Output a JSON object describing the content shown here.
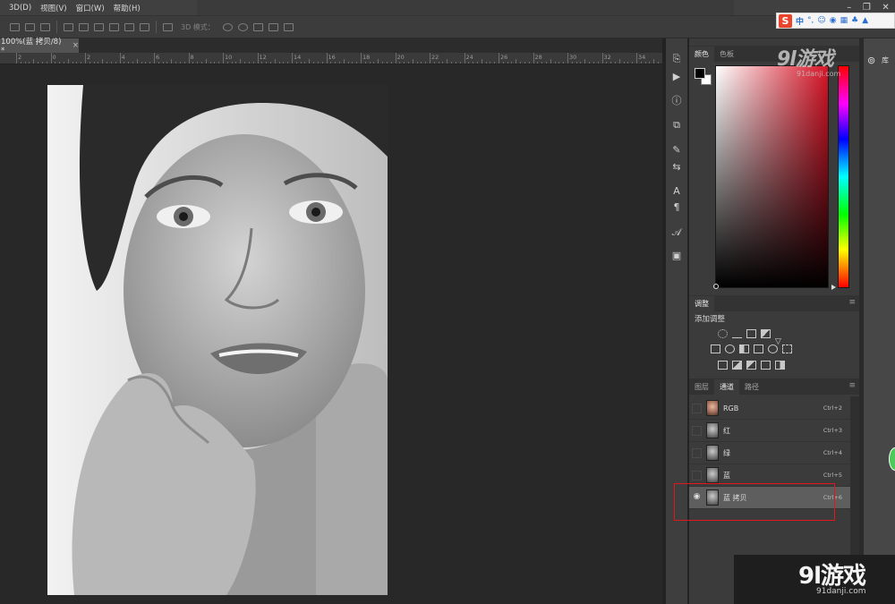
{
  "menubar": {
    "items": [
      "3D(D)",
      "视图(V)",
      "窗口(W)",
      "帮助(H)"
    ],
    "window_controls": [
      "–",
      "❐",
      "✕"
    ]
  },
  "options_bar": {
    "mode_3d_label": "3D 模式："
  },
  "document": {
    "tab_title": "100%(蓝 拷贝/8) *",
    "tab_close": "×"
  },
  "ruler": {
    "labels": [
      "2",
      "0",
      "2",
      "4",
      "6",
      "8",
      "10",
      "12",
      "14",
      "16",
      "18",
      "20",
      "22",
      "24",
      "26",
      "28",
      "30",
      "32",
      "34"
    ]
  },
  "color_panel": {
    "tabs": [
      "颜色",
      "色板"
    ],
    "active_tab": "颜色",
    "foreground": "#000000",
    "background": "#ffffff",
    "hue_color": "#d61426"
  },
  "adjustments_panel": {
    "title": "调整",
    "subtitle": "添加调整"
  },
  "channels_panel": {
    "tabs": [
      "图层",
      "通道",
      "路径"
    ],
    "active_tab": "通道",
    "channels": [
      {
        "name": "RGB",
        "shortcut": "Ctrl+2",
        "visible": false,
        "selected": false
      },
      {
        "name": "红",
        "shortcut": "Ctrl+3",
        "visible": false,
        "selected": false
      },
      {
        "name": "绿",
        "shortcut": "Ctrl+4",
        "visible": false,
        "selected": false
      },
      {
        "name": "蓝",
        "shortcut": "Ctrl+5",
        "visible": false,
        "selected": false
      },
      {
        "name": "蓝 拷贝",
        "shortcut": "Ctrl+6",
        "visible": true,
        "selected": true
      }
    ]
  },
  "library_panel": {
    "label": "库"
  },
  "ime": {
    "logo": "S",
    "mode": "中"
  },
  "watermark": {
    "brand": "9l游戏",
    "domain": "91danji.com"
  },
  "colors": {
    "highlight_box": "#e0171b",
    "selected_row": "#5e5e5e"
  }
}
